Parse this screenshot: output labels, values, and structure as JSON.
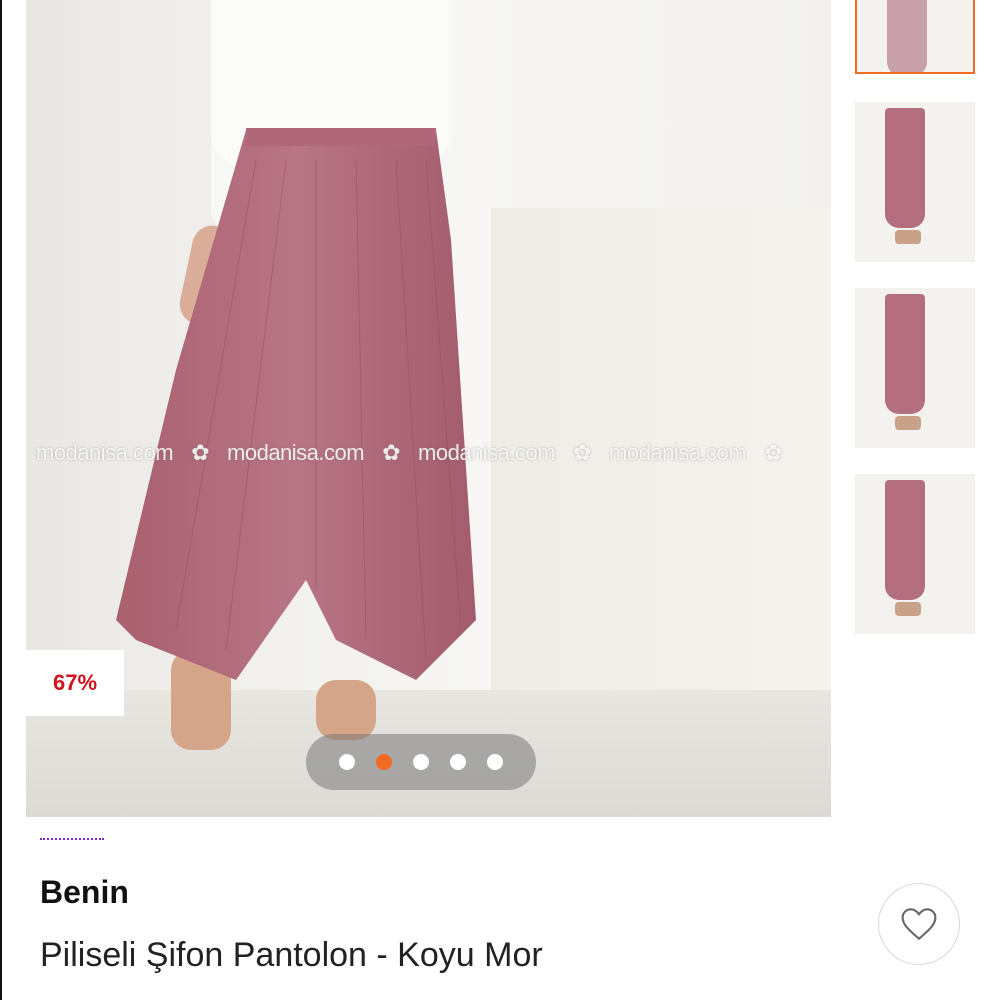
{
  "gallery": {
    "discount_badge": "67%",
    "watermark_text": "modanisa.com",
    "dots_count": 5,
    "active_dot_index": 1,
    "thumbnails_count": 4,
    "selected_thumbnail_index": 0
  },
  "product": {
    "brand": "Benin",
    "name": "Piliseli Şifon Pantolon - Koyu Mor"
  },
  "colors": {
    "accent": "#f26a21",
    "discount": "#d0121b",
    "pants": "#b36f7e"
  },
  "icons": {
    "favorite": "heart-outline-icon",
    "watermark_flower": "flower-icon"
  }
}
